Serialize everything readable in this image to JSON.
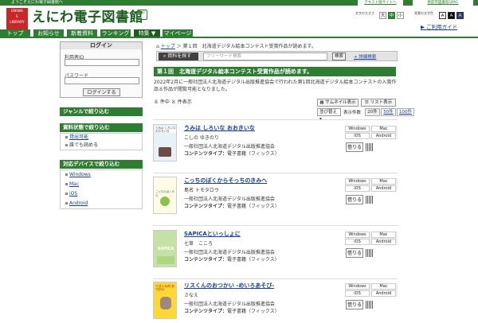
{
  "topbar": {
    "welcome": "ようこそえにわ電子図書館へ",
    "text_voice": "テキスト版サイトへ",
    "opac": "恵庭市図書館OPAC"
  },
  "logo": {
    "lines": [
      "ENIWA",
      "E",
      "LIBRARY"
    ]
  },
  "site": {
    "title": "えにわ電子図書館",
    "badge": "電子"
  },
  "access": {
    "size_label": "文字の大きさ",
    "sizes": [
      "大",
      "中",
      "小"
    ],
    "color_label": "背景の文字色",
    "colors": [
      "A",
      "A",
      "A"
    ],
    "guide": "ご利用ガイド"
  },
  "nav": {
    "items": [
      "トップ",
      "お知らせ",
      "新着資料",
      "ランキング",
      "特集 ▼",
      "マイページ"
    ]
  },
  "login": {
    "title": "ログイン",
    "user_label": "利用者ID",
    "pass_label": "パスワード",
    "button": "ログインする"
  },
  "sidebar": {
    "genre": "ジャンルで絞り込む",
    "status": "資料状態で絞り込む",
    "status_items": [
      "貸出可能",
      "誰でも読める"
    ],
    "device": "対応デバイスで絞り込む",
    "device_items": [
      "Windows",
      "Mac",
      "iOS",
      "Android"
    ]
  },
  "breadcrumb": {
    "home": "トップ",
    "current": "第１回　北海道デジタル絵本コンテスト受賞作品が読めます。"
  },
  "search": {
    "tag": "資料を探す",
    "placeholder": "フリーワード検索",
    "button": "検索",
    "advanced": "詳細検索"
  },
  "feature": {
    "title": "第１回　北海道デジタル絵本コンテスト受賞作品が読めます。",
    "description": "2022年2月に一般社団法人北海道デジタル出版推進協会で行われた第1回北海道デジタル絵本コンテストの入賞作品８作品が閲覧可能となりました。",
    "count": "８ 件中 ８ 件表示"
  },
  "view": {
    "thumb": "サムネイル表示",
    "list": "リスト表示",
    "sort": "並び替え",
    "per_label": "表示件数",
    "per": [
      "20件",
      "50件",
      "100件"
    ]
  },
  "items": [
    {
      "title": "うみは しろいな おおきいな",
      "author": "こしの ゆきのり",
      "publisher": "一般社団法人北海道デジタル出版推進協会",
      "ctype_label": "コンテンツタイプ：",
      "ctype": "電子書籍（フィックス）",
      "cover_text": "うみは しろいな おおきいな"
    },
    {
      "title": "こっちのぼくからそっちのきみへ",
      "author": "島名 トモタロウ",
      "publisher": "一般社団法人北海道デジタル出版推進協会",
      "ctype_label": "コンテンツタイプ：",
      "ctype": "電子書籍（フィックス）",
      "cover_text": "こっちのぼくから"
    },
    {
      "title": "SAPICAといっしょに",
      "author": "七草　こころ",
      "publisher": "一般社団法人北海道デジタル出版推進協会",
      "ctype_label": "コンテンツタイプ：",
      "ctype": "電子書籍（フィックス）",
      "cover_text": "SAPICA"
    },
    {
      "title": "リスくんのおつかい -めいろあそび-",
      "author": "さなえ",
      "publisher": "一般社団法人北海道デジタル出版推進協会",
      "ctype_label": "コンテンツタイプ：",
      "ctype": "電子書籍（フィックス）",
      "cover_text": "リスくんの おつかい"
    }
  ],
  "devices": [
    "Windows",
    "Mac",
    "iOS",
    "Android"
  ],
  "borrow_label": "借りる"
}
